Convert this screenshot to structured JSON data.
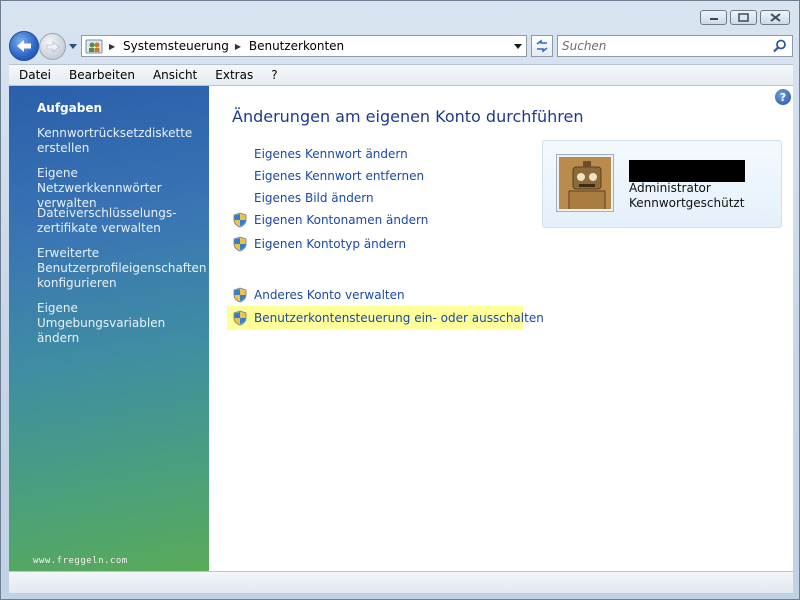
{
  "address": {
    "crumbs": [
      "Systemsteuerung",
      "Benutzerkonten"
    ],
    "icon": "control-panel-users-icon"
  },
  "search": {
    "placeholder": "Suchen"
  },
  "menu": [
    "Datei",
    "Bearbeiten",
    "Ansicht",
    "Extras",
    "?"
  ],
  "tasks": {
    "title": "Aufgaben",
    "items": [
      "Kennwortrücksetzdiskette erstellen",
      "Eigene Netzwerkkennwörter verwalten",
      "Dateiverschlüsselungs-zertifikate verwalten",
      "Erweiterte Benutzerprofileigenschaften konfigurieren",
      "Eigene Umgebungsvariablen ändern"
    ],
    "watermark": "www.freggeln.com"
  },
  "main": {
    "title": "Änderungen am eigenen Konto durchführen",
    "links": [
      "Eigenes Kennwort ändern",
      "Eigenes Kennwort entfernen",
      "Eigenes Bild ändern",
      "Eigenen Kontonamen ändern",
      "Eigenen Kontotyp ändern"
    ],
    "other_links": [
      "Anderes Konto verwalten",
      "Benutzerkontensteuerung ein- oder ausschalten"
    ],
    "help": "?"
  },
  "account": {
    "role": "Administrator",
    "password_state": "Kennwortgeschützt"
  },
  "colors": {
    "link": "#1a49a8",
    "title": "#1e3a8c",
    "highlight": "#ffff99"
  }
}
